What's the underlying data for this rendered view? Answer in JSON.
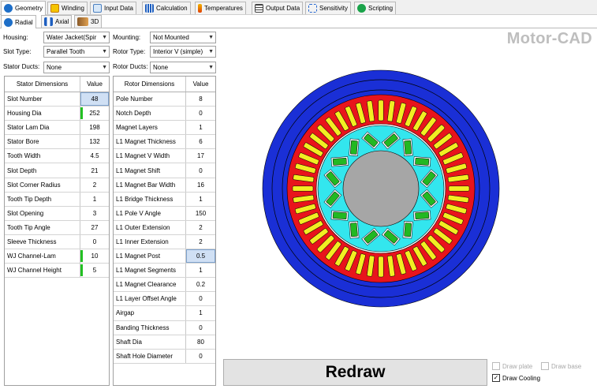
{
  "app_title": "Motor-CAD",
  "main_tabs": [
    {
      "label": "Geometry",
      "icon": "geometry-icon",
      "active": true
    },
    {
      "label": "Winding",
      "icon": "winding-icon"
    },
    {
      "label": "Input Data",
      "icon": "input-data-icon"
    },
    {
      "label": "Calculation",
      "icon": "calculation-icon"
    },
    {
      "label": "Temperatures",
      "icon": "temperatures-icon"
    },
    {
      "label": "Output Data",
      "icon": "output-data-icon"
    },
    {
      "label": "Sensitivity",
      "icon": "sensitivity-icon"
    },
    {
      "label": "Scripting",
      "icon": "scripting-icon"
    }
  ],
  "sub_tabs": [
    {
      "label": "Radial",
      "icon": "radial-icon",
      "active": true
    },
    {
      "label": "Axial",
      "icon": "axial-icon"
    },
    {
      "label": "3D",
      "icon": "3d-icon"
    }
  ],
  "selectors": {
    "housing_label": "Housing:",
    "housing_value": "Water Jacket(Spir",
    "slot_type_label": "Slot Type:",
    "slot_type_value": "Parallel Tooth",
    "stator_ducts_label": "Stator Ducts:",
    "stator_ducts_value": "None",
    "mounting_label": "Mounting:",
    "mounting_value": "Not Mounted",
    "rotor_type_label": "Rotor Type:",
    "rotor_type_value": "Interior V (simple)",
    "rotor_ducts_label": "Rotor Ducts:",
    "rotor_ducts_value": "None"
  },
  "stator_table": {
    "header_name": "Stator Dimensions",
    "header_value": "Value",
    "rows": [
      {
        "name": "Slot Number",
        "value": "48",
        "selected": true
      },
      {
        "name": "Housing Dia",
        "value": "252",
        "flag": true
      },
      {
        "name": "Stator Lam Dia",
        "value": "198"
      },
      {
        "name": "Stator Bore",
        "value": "132"
      },
      {
        "name": "Tooth Width",
        "value": "4.5"
      },
      {
        "name": "Slot Depth",
        "value": "21"
      },
      {
        "name": "Slot Corner Radius",
        "value": "2"
      },
      {
        "name": "Tooth Tip Depth",
        "value": "1"
      },
      {
        "name": "Slot Opening",
        "value": "3"
      },
      {
        "name": "Tooth Tip Angle",
        "value": "27"
      },
      {
        "name": "Sleeve Thickness",
        "value": "0"
      },
      {
        "name": "WJ Channel-Lam",
        "value": "10",
        "flag": true
      },
      {
        "name": "WJ Channel Height",
        "value": "5",
        "flag": true
      }
    ]
  },
  "rotor_table": {
    "header_name": "Rotor Dimensions",
    "header_value": "Value",
    "rows": [
      {
        "name": "Pole Number",
        "value": "8"
      },
      {
        "name": "Notch Depth",
        "value": "0"
      },
      {
        "name": "Magnet Layers",
        "value": "1"
      },
      {
        "name": "L1 Magnet Thickness",
        "value": "6"
      },
      {
        "name": "L1 Magnet V Width",
        "value": "17"
      },
      {
        "name": "L1 Magnet Shift",
        "value": "0"
      },
      {
        "name": "L1 Magnet Bar Width",
        "value": "16"
      },
      {
        "name": "L1 Bridge Thickness",
        "value": "1"
      },
      {
        "name": "L1 Pole V Angle",
        "value": "150"
      },
      {
        "name": "L1 Outer Extension",
        "value": "2"
      },
      {
        "name": "L1 Inner Extension",
        "value": "2"
      },
      {
        "name": "L1 Magnet Post",
        "value": "0.5",
        "selected": true
      },
      {
        "name": "L1 Magnet Segments",
        "value": "1"
      },
      {
        "name": "L1 Magnet Clearance",
        "value": "0.2"
      },
      {
        "name": "L1 Layer Offset Angle",
        "value": "0"
      },
      {
        "name": "Airgap",
        "value": "1"
      },
      {
        "name": "Banding Thickness",
        "value": "0"
      },
      {
        "name": "Shaft Dia",
        "value": "80"
      },
      {
        "name": "Shaft Hole Diameter",
        "value": "0"
      }
    ]
  },
  "redraw_label": "Redraw",
  "options": {
    "draw_plate": {
      "label": "Draw plate",
      "checked": false,
      "enabled": false
    },
    "draw_base": {
      "label": "Draw base",
      "checked": false,
      "enabled": false
    },
    "draw_cooling": {
      "label": "Draw Cooling",
      "checked": true,
      "enabled": true
    }
  },
  "colors": {
    "housing": "#1a2fd6",
    "stator_lam": "#e8141c",
    "winding": "#f2ee22",
    "rotor": "#33e6ee",
    "magnet": "#22b822",
    "shaft": "#a6a6a6",
    "selection": "#d0e0f4"
  }
}
